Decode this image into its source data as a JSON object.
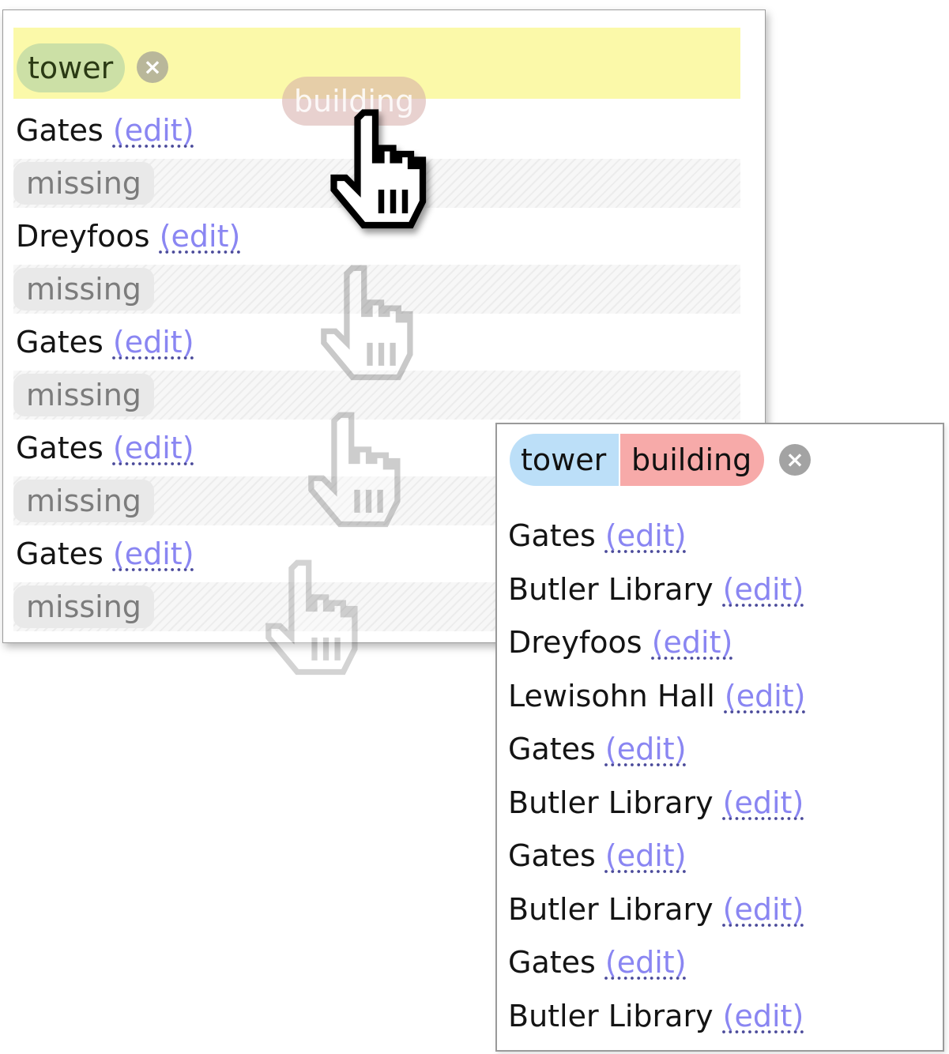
{
  "panel_a": {
    "tags": [
      {
        "label": "tower",
        "color": "#cce0a6"
      }
    ],
    "dragging_tag": "building",
    "remove_icon": "x-circle-icon",
    "rows": [
      {
        "name": "Gates",
        "edit": "(edit)",
        "status": "missing"
      },
      {
        "name": "Dreyfoos",
        "edit": "(edit)",
        "status": "missing"
      },
      {
        "name": "Gates",
        "edit": "(edit)",
        "status": "missing"
      },
      {
        "name": "Gates",
        "edit": "(edit)",
        "status": "missing"
      },
      {
        "name": "Gates",
        "edit": "(edit)",
        "status": "missing"
      }
    ],
    "tagbar_color": "#fbf9a9"
  },
  "panel_b": {
    "tags": [
      {
        "label": "tower",
        "color": "#bcdff8"
      },
      {
        "label": "building",
        "color": "#f7aaa9"
      }
    ],
    "remove_icon": "x-circle-icon",
    "rows": [
      {
        "name": "Gates",
        "edit": "(edit)"
      },
      {
        "name": "Butler Library",
        "edit": "(edit)"
      },
      {
        "name": "Dreyfoos",
        "edit": "(edit)"
      },
      {
        "name": "Lewisohn Hall",
        "edit": "(edit)"
      },
      {
        "name": "Gates",
        "edit": "(edit)"
      },
      {
        "name": "Butler Library",
        "edit": "(edit)"
      },
      {
        "name": "Gates",
        "edit": "(edit)"
      },
      {
        "name": "Butler Library",
        "edit": "(edit)"
      },
      {
        "name": "Gates",
        "edit": "(edit)"
      },
      {
        "name": "Butler Library",
        "edit": "(edit)"
      }
    ]
  },
  "cursor_icon": "hand-pointer-icon",
  "link_color": "#8a86f2"
}
